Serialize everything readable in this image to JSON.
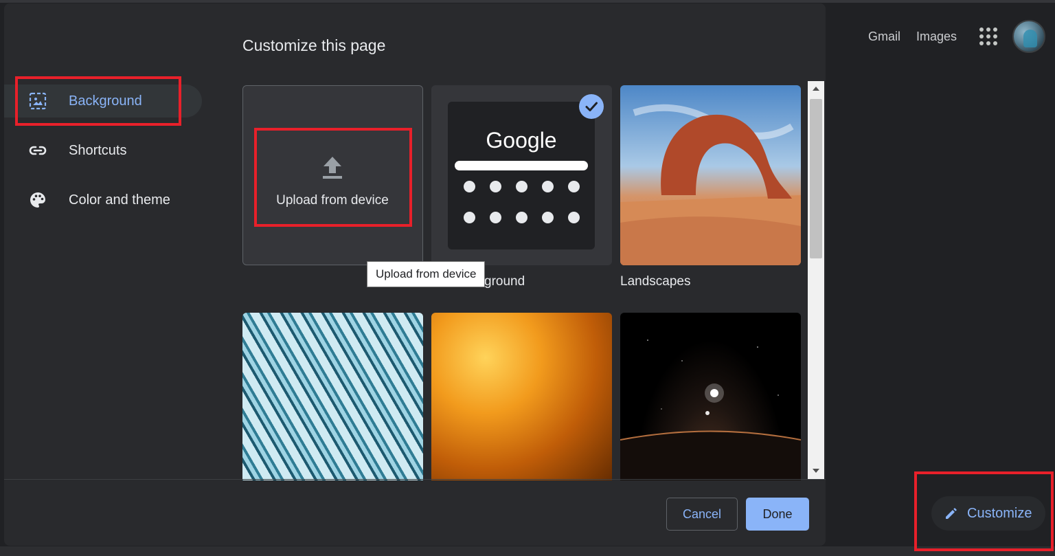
{
  "dialog": {
    "title": "Customize this page",
    "nav": [
      {
        "label": "Background",
        "icon": "image-icon",
        "selected": true
      },
      {
        "label": "Shortcuts",
        "icon": "link-icon",
        "selected": false
      },
      {
        "label": "Color and theme",
        "icon": "palette-icon",
        "selected": false
      }
    ],
    "tiles": {
      "upload": {
        "label": "Upload from device"
      },
      "no_background": {
        "logo_text": "Google",
        "label": "ground",
        "selected": true
      },
      "landscapes": {
        "label": "Landscapes"
      }
    },
    "tooltip": "Upload from device",
    "buttons": {
      "cancel": "Cancel",
      "done": "Done"
    }
  },
  "header": {
    "links": [
      "Gmail",
      "Images"
    ],
    "apps_icon": "apps-grid-icon",
    "avatar_icon": "account-avatar"
  },
  "customize_button": {
    "label": "Customize",
    "icon": "pencil-icon"
  },
  "colors": {
    "accent": "#8ab4f8",
    "background": "#202124",
    "dialog": "#292a2d",
    "highlight": "#e8202a"
  }
}
